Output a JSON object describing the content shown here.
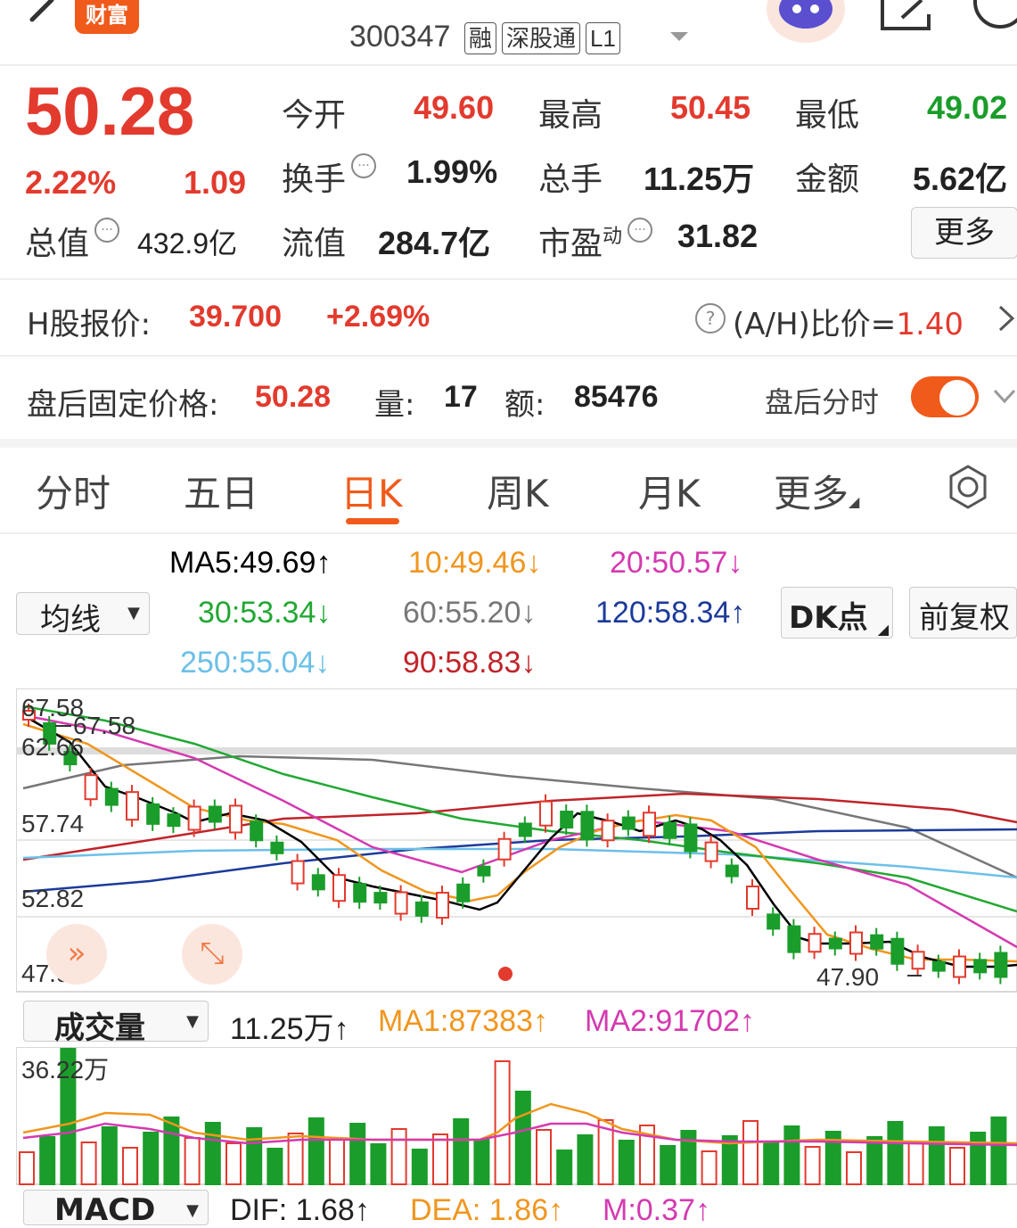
{
  "header": {
    "brand_label": "财富",
    "stock_code": "300347",
    "tags": [
      "融",
      "深股通",
      "L1"
    ]
  },
  "quote": {
    "price": "50.28",
    "change_pct": "2.22%",
    "change_amt": "1.09",
    "open_label": "今开",
    "open": "49.60",
    "high_label": "最高",
    "high": "50.45",
    "low_label": "最低",
    "low": "49.02",
    "turnover_label": "换手",
    "turnover": "1.99%",
    "volume_label": "总手",
    "volume": "11.25万",
    "amount_label": "金额",
    "amount": "5.62亿",
    "mktcap_label": "总值",
    "mktcap": "432.9亿",
    "float_label": "流值",
    "float_cap": "284.7亿",
    "pe_label": "市盈",
    "pe_sup": "动",
    "pe": "31.82",
    "more_button": "更多"
  },
  "hshare": {
    "label": "H股报价:",
    "price": "39.700",
    "change": "+2.69%",
    "ah_label": "(A/H)比价=",
    "ah_value": "1.40"
  },
  "afterhours": {
    "label": "盘后固定价格:",
    "price": "50.28",
    "vol_label": "量:",
    "vol": "17",
    "amt_label": "额:",
    "amt": "85476",
    "toggle_label": "盘后分时",
    "toggle_on": true
  },
  "tabs": [
    "分时",
    "五日",
    "日K",
    "周K",
    "月K",
    "更多"
  ],
  "active_tab": "日K",
  "ma_legend": {
    "selector": "均线",
    "ma5": "MA5:49.69↑",
    "ma10": "10:49.46↓",
    "ma20": "20:50.57↓",
    "ma30": "30:53.34↓",
    "ma60": "60:55.20↓",
    "ma120": "120:58.34↑",
    "ma250": "250:55.04↓",
    "ma90": "90:58.83↓",
    "dk_button": "DK点",
    "adjust_button": "前复权"
  },
  "colors": {
    "up": "#e33a2e",
    "down": "#1a9d2a",
    "accent": "#f05a1a",
    "ma5": "#000000",
    "ma10": "#f0961e",
    "ma20": "#d43ab0",
    "ma30": "#22a833",
    "ma60": "#777777",
    "ma120": "#1c3a9a",
    "ma250": "#6cc0e8",
    "ma90": "#c0242a"
  },
  "kline_labels": {
    "y_ticks": [
      "67.58",
      "62.66",
      "57.74",
      "52.82",
      "47.90"
    ],
    "high_marker": "67.58",
    "low_marker": "47.90"
  },
  "volume": {
    "selector": "成交量",
    "value": "11.25万↑",
    "ma1": "MA1:87383↑",
    "ma2": "MA2:91702↑",
    "max_label": "36.22万"
  },
  "macd": {
    "selector": "MACD",
    "dif": "DIF: 1.68↑",
    "dea": "DEA: 1.86↑",
    "m": "M:0.37↑"
  },
  "icons": [
    "back-arrow-icon",
    "robot-avatar-icon",
    "share-icon",
    "search-icon",
    "gear-icon",
    "expand-icon",
    "double-chevron-icon",
    "help-icon",
    "chevron-right-icon",
    "chevron-down-icon"
  ]
}
